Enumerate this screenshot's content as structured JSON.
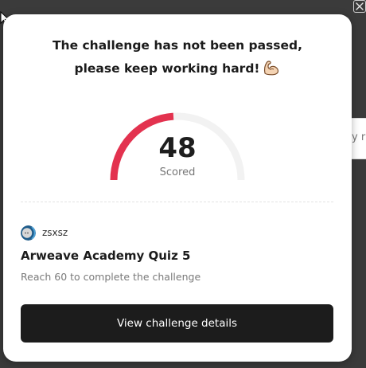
{
  "window": {
    "close_label": "×"
  },
  "background": {
    "partial_text": "y r"
  },
  "modal": {
    "headline_line1": "The challenge has not been passed,",
    "headline_line2": "please keep working hard!",
    "headline_emoji": "flexed-biceps-icon",
    "score": {
      "value": "48",
      "label": "Scored",
      "fraction_of_max": 0.48,
      "progress_color": "#e3324f",
      "track_color": "#f2f2f2"
    },
    "author": {
      "name": "zsxsz",
      "avatar_icon": "planet-avatar-icon"
    },
    "quiz_title": "Arweave Academy Quiz 5",
    "requirement": "Reach 60 to complete the challenge",
    "cta_label": "View challenge details"
  },
  "colors": {
    "cta_background": "#1c1c1c",
    "cta_text": "#ffffff",
    "overlay": "#3a3a3a"
  }
}
